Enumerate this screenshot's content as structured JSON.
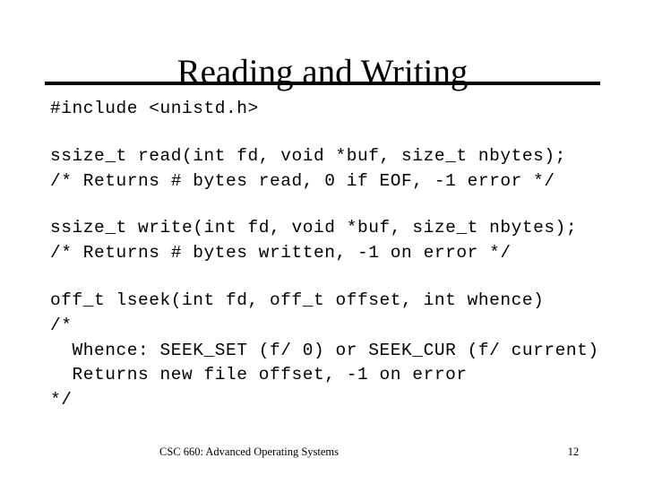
{
  "slide": {
    "title": "Reading and Writing",
    "background_color": "#ffffff",
    "text_color": "#000000",
    "rule_color": "#000000"
  },
  "code": {
    "lines": [
      "#include <unistd.h>",
      "",
      "ssize_t read(int fd, void *buf, size_t nbytes);",
      "/* Returns # bytes read, 0 if EOF, -1 error */",
      "",
      "ssize_t write(int fd, void *buf, size_t nbytes);",
      "/* Returns # bytes written, -1 on error */",
      "",
      "off_t lseek(int fd, off_t offset, int whence)",
      "/*",
      "  Whence: SEEK_SET (f/ 0) or SEEK_CUR (f/ current)",
      "  Returns new file offset, -1 on error",
      "*/"
    ]
  },
  "footer": {
    "course": "CSC 660: Advanced Operating Systems",
    "page_number": "12"
  }
}
